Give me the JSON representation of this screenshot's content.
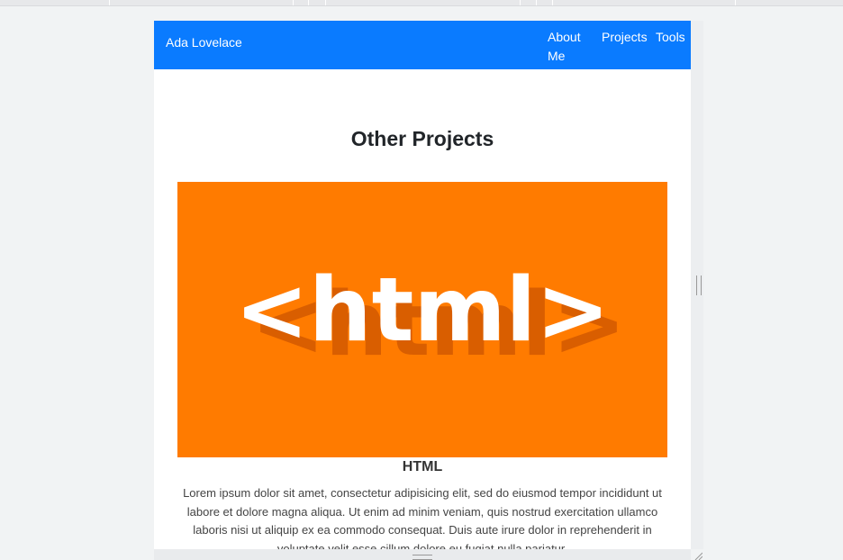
{
  "navbar": {
    "brand": "Ada Lovelace",
    "links": [
      "About Me",
      "Projects",
      "Tools"
    ]
  },
  "main": {
    "section_title": "Other Projects",
    "project": {
      "image_text": "<html>",
      "name": "HTML",
      "description": "Lorem ipsum dolor sit amet, consectetur adipisicing elit, sed do eiusmod tempor incididunt ut labore et dolore magna aliqua. Ut enim ad minim veniam, quis nostrud exercitation ullamco laboris nisi ut aliquip ex ea commodo consequat. Duis aute irure dolor in reprehenderit in voluptate velit esse cillum dolore eu fugiat nulla pariatur."
    }
  },
  "colors": {
    "navbar": "#0a7bff",
    "image_bg": "#ff7b00",
    "image_shadow": "#d95e00",
    "text": "#212529"
  },
  "icons": [
    "resize-handle-icon",
    "corner-resize-icon"
  ]
}
